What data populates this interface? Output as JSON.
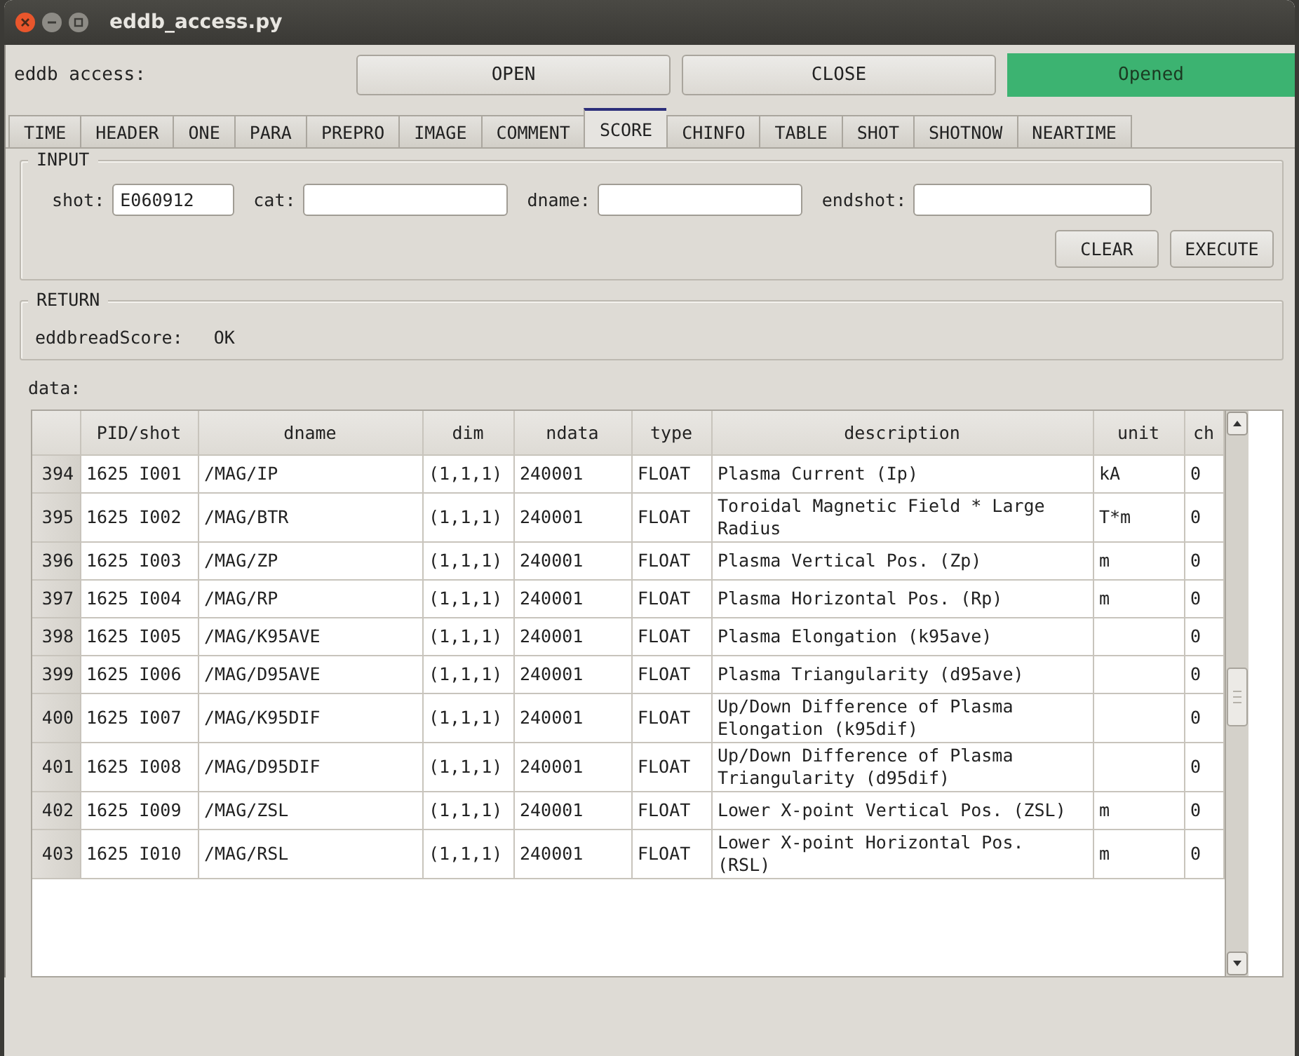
{
  "window": {
    "title": "eddb_access.py"
  },
  "toolbar": {
    "label": "eddb access:",
    "buttons": [
      "OPEN",
      "CLOSE"
    ],
    "status": {
      "text": "Opened",
      "kind": "ok"
    }
  },
  "tabs": [
    {
      "label": "TIME",
      "selected": false
    },
    {
      "label": "HEADER",
      "selected": false
    },
    {
      "label": "ONE",
      "selected": false
    },
    {
      "label": "PARA",
      "selected": false
    },
    {
      "label": "PREPRO",
      "selected": false
    },
    {
      "label": "IMAGE",
      "selected": false
    },
    {
      "label": "COMMENT",
      "selected": false
    },
    {
      "label": "SCORE",
      "selected": true
    },
    {
      "label": "CHINFO",
      "selected": false
    },
    {
      "label": "TABLE",
      "selected": false
    },
    {
      "label": "SHOT",
      "selected": false
    },
    {
      "label": "SHOTNOW",
      "selected": false
    },
    {
      "label": "NEARTIME",
      "selected": false
    }
  ],
  "input": {
    "title": "INPUT",
    "fields": [
      {
        "label": "shot:",
        "value": "E060912"
      },
      {
        "label": "cat:"
      },
      {
        "label": "dname:"
      },
      {
        "label": "endshot:"
      }
    ],
    "buttons": [
      "CLEAR",
      "EXECUTE"
    ]
  },
  "return": {
    "title": "RETURN",
    "label": "eddbreadScore:",
    "value": "OK"
  },
  "data": {
    "label": "data:",
    "columns": [
      "PID/shot",
      "dname",
      "dim",
      "ndata",
      "type",
      "description",
      "unit",
      "ch"
    ],
    "rows": [
      {
        "index": "394",
        "cells": [
          "1625 I001",
          "/MAG/IP",
          "(1,1,1)",
          "240001",
          "FLOAT",
          "Plasma Current (Ip)",
          "kA",
          "0"
        ]
      },
      {
        "index": "395",
        "cells": [
          "1625 I002",
          "/MAG/BTR",
          "(1,1,1)",
          "240001",
          "FLOAT",
          "Toroidal Magnetic Field * Large Radius",
          "T*m",
          "0"
        ]
      },
      {
        "index": "396",
        "cells": [
          "1625 I003",
          "/MAG/ZP",
          "(1,1,1)",
          "240001",
          "FLOAT",
          "Plasma Vertical Pos. (Zp)",
          "m",
          "0"
        ]
      },
      {
        "index": "397",
        "cells": [
          "1625 I004",
          "/MAG/RP",
          "(1,1,1)",
          "240001",
          "FLOAT",
          "Plasma Horizontal Pos. (Rp)",
          "m",
          "0"
        ]
      },
      {
        "index": "398",
        "cells": [
          "1625 I005",
          "/MAG/K95AVE",
          "(1,1,1)",
          "240001",
          "FLOAT",
          "Plasma Elongation (k95ave)",
          "",
          "0"
        ]
      },
      {
        "index": "399",
        "cells": [
          "1625 I006",
          "/MAG/D95AVE",
          "(1,1,1)",
          "240001",
          "FLOAT",
          "Plasma Triangularity (d95ave)",
          "",
          "0"
        ]
      },
      {
        "index": "400",
        "cells": [
          "1625 I007",
          "/MAG/K95DIF",
          "(1,1,1)",
          "240001",
          "FLOAT",
          "Up/Down Difference of Plasma Elongation (k95dif)",
          "",
          "0"
        ]
      },
      {
        "index": "401",
        "cells": [
          "1625 I008",
          "/MAG/D95DIF",
          "(1,1,1)",
          "240001",
          "FLOAT",
          "Up/Down Difference of Plasma Triangularity (d95dif)",
          "",
          "0"
        ]
      },
      {
        "index": "402",
        "cells": [
          "1625 I009",
          "/MAG/ZSL",
          "(1,1,1)",
          "240001",
          "FLOAT",
          "Lower X-point Vertical Pos. (ZSL)",
          "m",
          "0"
        ]
      },
      {
        "index": "403",
        "cells": [
          "1625 I010",
          "/MAG/RSL",
          "(1,1,1)",
          "240001",
          "FLOAT",
          "Lower X-point Horizontal Pos. (RSL)",
          "m",
          "0"
        ]
      }
    ]
  }
}
